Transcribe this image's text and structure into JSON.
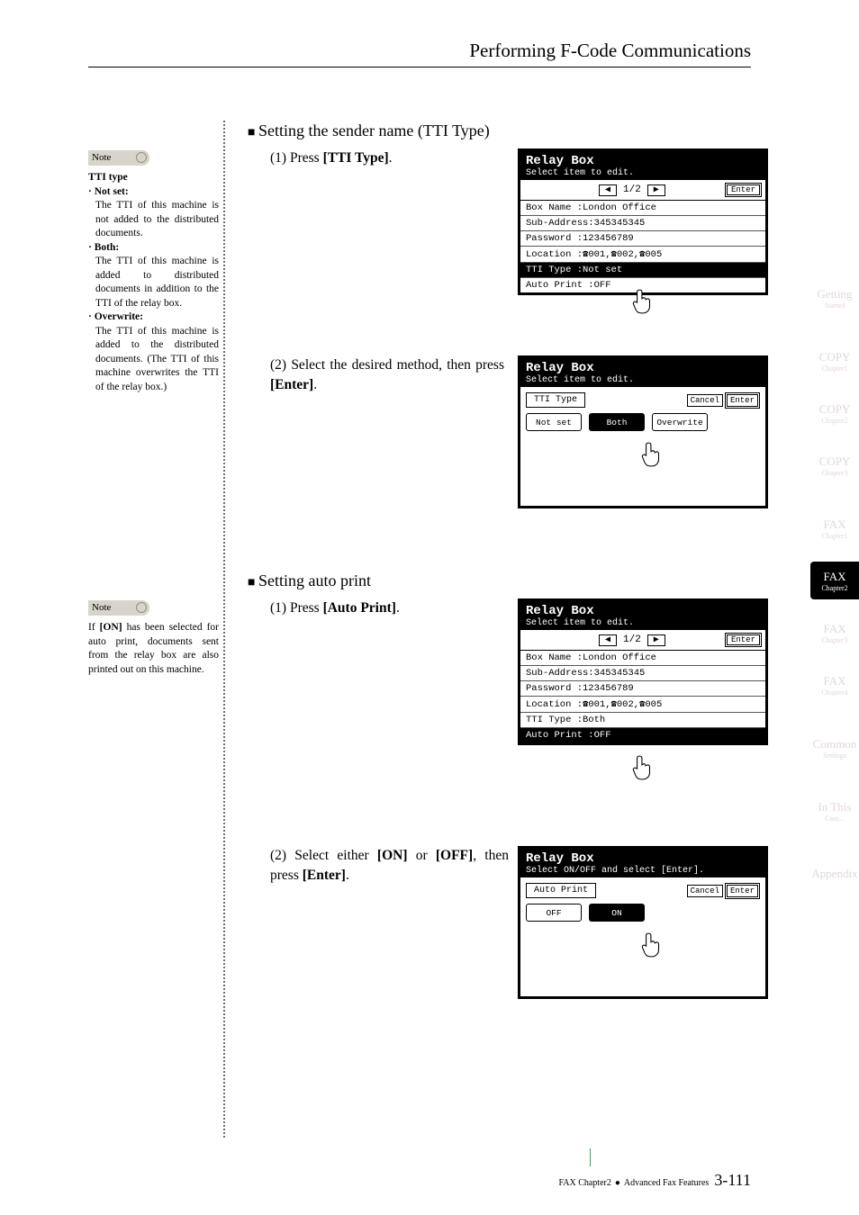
{
  "header": {
    "title": "Performing F-Code Communications"
  },
  "note_label": "Note",
  "sidebar1": {
    "heading": "TTI type",
    "items": [
      {
        "label": "· Not set:",
        "body": "The TTI of this machine is not added to the distributed documents."
      },
      {
        "label": "· Both:",
        "body": "The TTI of this machine is added to distributed documents in addition to the TTI of the relay box."
      },
      {
        "label": "· Overwrite:",
        "body": "The TTI of this machine is added to the distributed documents. (The TTI of this machine overwrites the TTI of the relay box.)"
      }
    ]
  },
  "sidebar2": {
    "body_a": "If ",
    "body_bold": "[ON]",
    "body_b": " has been selected for auto print, documents sent from the relay box are also printed out on this machine."
  },
  "sections": {
    "a": {
      "heading": "Setting the sender name (TTI Type)"
    },
    "b": {
      "heading": "Setting auto print"
    }
  },
  "steps": {
    "a1_a": "(1) Press ",
    "a1_bold": "[TTI Type]",
    "a1_b": ".",
    "a2_a": "(2) Select the desired method, then press ",
    "a2_bold": "[Enter]",
    "a2_b": ".",
    "b1_a": "(1) Press ",
    "b1_bold": "[Auto Print]",
    "b1_b": ".",
    "b2_a": "(2) Select either ",
    "b2_bold1": "[ON]",
    "b2_mid": " or ",
    "b2_bold2": "[OFF]",
    "b2_c": ", then press ",
    "b2_bold3": "[Enter]",
    "b2_d": "."
  },
  "lcd": {
    "title": "Relay Box",
    "sub_edit": "Select item to edit.",
    "sub_onoff": "Select ON/OFF and select [Enter].",
    "page": "1/2",
    "enter": "Enter",
    "cancel": "Cancel",
    "rows": {
      "boxname": "Box Name   :London Office",
      "subaddr": "Sub-Address:345345345",
      "password": "Password   :123456789",
      "location": "Location   :☎001,☎002,☎005",
      "tti_notset": "TTI Type   :Not set",
      "tti_both": "TTI Type   :Both",
      "autoprint": "Auto Print :OFF"
    },
    "dlg_tti": {
      "label": "TTI Type",
      "opts": [
        "Not set",
        "Both",
        "Overwrite"
      ],
      "sel": 1
    },
    "dlg_auto": {
      "label": "Auto Print",
      "opts": [
        "OFF",
        "ON"
      ],
      "sel": 1
    }
  },
  "rtabs": [
    {
      "l1": "Getting",
      "l2": "Started",
      "cls": "ghost"
    },
    {
      "l1": "COPY",
      "l2": "Chapter1",
      "cls": "ghost"
    },
    {
      "l1": "COPY",
      "l2": "Chapter2",
      "cls": "ghost"
    },
    {
      "l1": "COPY",
      "l2": "Chapter3",
      "cls": "ghost"
    },
    {
      "l1": "FAX",
      "l2": "Chapter1",
      "cls": "ghost"
    },
    {
      "l1": "FAX",
      "l2": "Chapter2",
      "cls": "active"
    },
    {
      "l1": "FAX",
      "l2": "Chapter3",
      "cls": "ghost"
    },
    {
      "l1": "FAX",
      "l2": "Chapter4",
      "cls": "ghost"
    },
    {
      "l1": "Common",
      "l2": "Settings",
      "cls": "ghost"
    },
    {
      "l1": "In This",
      "l2": "Case...",
      "cls": "ghost"
    },
    {
      "l1": "Appendix",
      "l2": "",
      "cls": "ghost"
    }
  ],
  "footer": {
    "left": "FAX Chapter2",
    "mid": "Advanced Fax Features",
    "page": "3-111"
  }
}
